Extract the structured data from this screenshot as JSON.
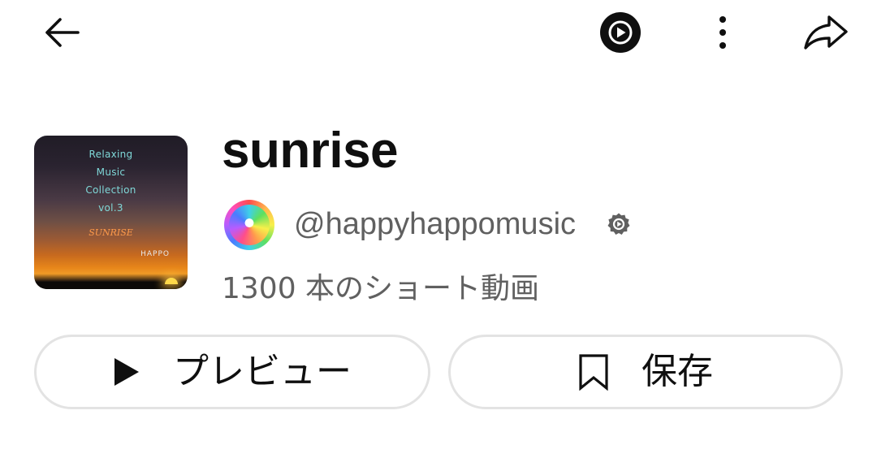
{
  "top_bar": {
    "back_icon": "arrow-left-icon",
    "music_icon": "youtube-music-icon",
    "more_icon": "more-vertical-icon",
    "share_icon": "share-icon"
  },
  "playlist": {
    "title": "sunrise",
    "album_art": {
      "lines": [
        "Relaxing",
        "Music",
        "Collection",
        "vol.3"
      ],
      "subtitle": "SUNRISE",
      "artist": "HAPPO"
    },
    "channel_handle": "@happyhappomusic",
    "verified_icon": "verified-badge-icon",
    "video_count": "1300 本のショート動画"
  },
  "actions": {
    "preview_label": "プレビュー",
    "preview_icon": "play-icon",
    "save_label": "保存",
    "save_icon": "bookmark-icon"
  },
  "colors": {
    "text_primary": "#0f0f0f",
    "text_secondary": "#606060",
    "border": "#e3e3e3"
  }
}
